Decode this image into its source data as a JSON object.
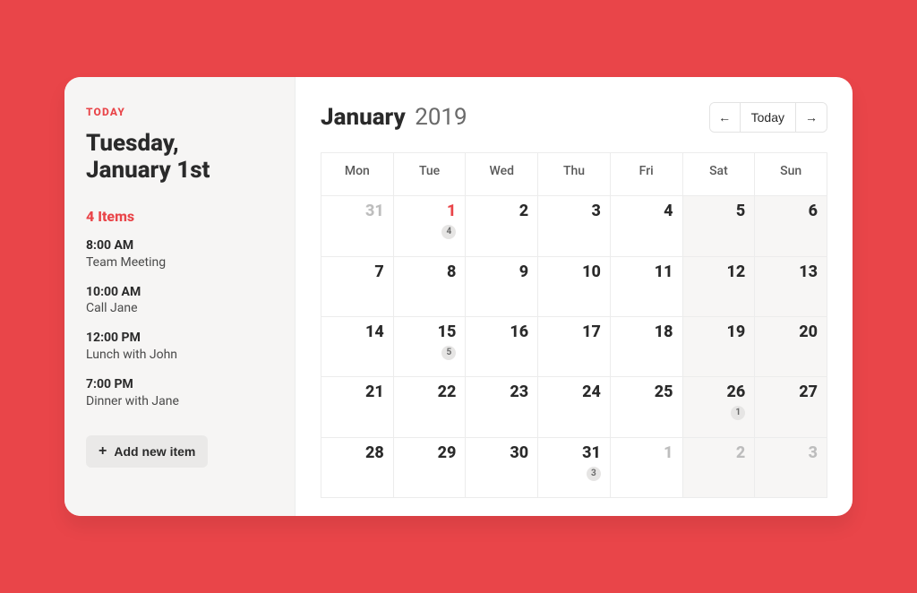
{
  "sidebar": {
    "today_label": "TODAY",
    "date_line1": "Tuesday,",
    "date_line2": "January 1st",
    "items_count": "4 Items",
    "agenda": [
      {
        "time": "8:00 AM",
        "title": "Team Meeting"
      },
      {
        "time": "10:00 AM",
        "title": "Call Jane"
      },
      {
        "time": "12:00 PM",
        "title": "Lunch with John"
      },
      {
        "time": "7:00 PM",
        "title": "Dinner with Jane"
      }
    ],
    "add_label": "Add new item"
  },
  "header": {
    "month": "January",
    "year": "2019",
    "today_button": "Today"
  },
  "calendar": {
    "dow": [
      "Mon",
      "Tue",
      "Wed",
      "Thu",
      "Fri",
      "Sat",
      "Sun"
    ],
    "weeks": [
      [
        {
          "n": 31,
          "muted": true
        },
        {
          "n": 1,
          "today": true,
          "badge": 4
        },
        {
          "n": 2
        },
        {
          "n": 3
        },
        {
          "n": 4
        },
        {
          "n": 5,
          "weekend": true
        },
        {
          "n": 6,
          "weekend": true
        }
      ],
      [
        {
          "n": 7
        },
        {
          "n": 8
        },
        {
          "n": 9
        },
        {
          "n": 10
        },
        {
          "n": 11
        },
        {
          "n": 12,
          "weekend": true
        },
        {
          "n": 13,
          "weekend": true
        }
      ],
      [
        {
          "n": 14
        },
        {
          "n": 15,
          "badge": 5
        },
        {
          "n": 16
        },
        {
          "n": 17
        },
        {
          "n": 18
        },
        {
          "n": 19,
          "weekend": true
        },
        {
          "n": 20,
          "weekend": true
        }
      ],
      [
        {
          "n": 21
        },
        {
          "n": 22
        },
        {
          "n": 23
        },
        {
          "n": 24
        },
        {
          "n": 25
        },
        {
          "n": 26,
          "weekend": true,
          "badge": 1
        },
        {
          "n": 27,
          "weekend": true
        }
      ],
      [
        {
          "n": 28
        },
        {
          "n": 29
        },
        {
          "n": 30
        },
        {
          "n": 31,
          "badge": 3
        },
        {
          "n": 1,
          "muted": true
        },
        {
          "n": 2,
          "muted": true,
          "weekend": true
        },
        {
          "n": 3,
          "muted": true,
          "weekend": true
        }
      ]
    ]
  }
}
